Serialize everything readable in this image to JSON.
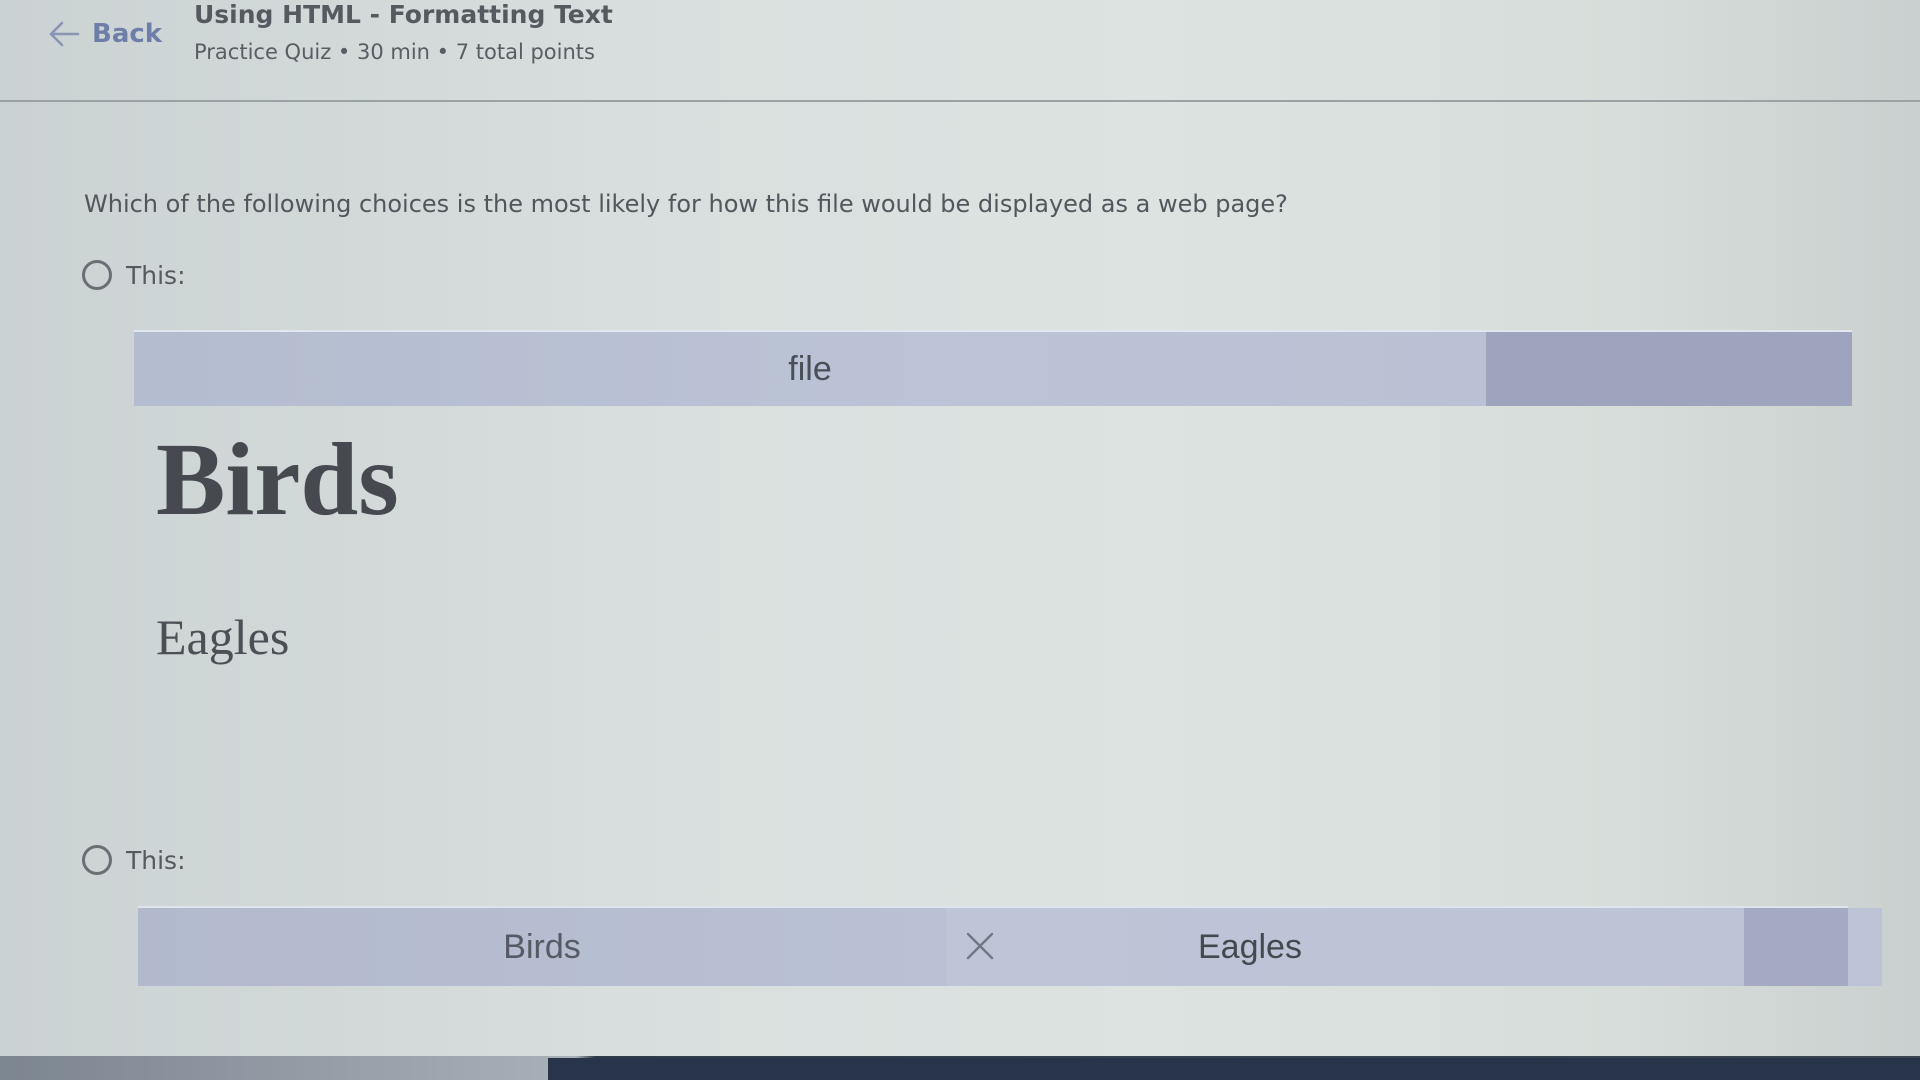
{
  "header": {
    "back_label": "Back",
    "title": "Using HTML - Formatting Text",
    "subtitle": "Practice Quiz • 30 min • 7 total points"
  },
  "question": {
    "text": "Which of the following choices is the most likely for how this file would be displayed as a web page?"
  },
  "options": [
    {
      "label": "This:",
      "selected": false,
      "preview": {
        "tab_title": "file",
        "heading": "Birds",
        "paragraph": "Eagles"
      }
    },
    {
      "label": "This:",
      "selected": false,
      "preview": {
        "tab_left": "Birds",
        "tab_right": "Eagles"
      }
    }
  ],
  "colors": {
    "accent": "#6f7ea8",
    "tab_bar": "#b9bfd2",
    "text": "#4a4f55"
  },
  "icons": {
    "back": "arrow-left-icon",
    "radio": "radio-circle-icon",
    "close": "close-icon"
  }
}
